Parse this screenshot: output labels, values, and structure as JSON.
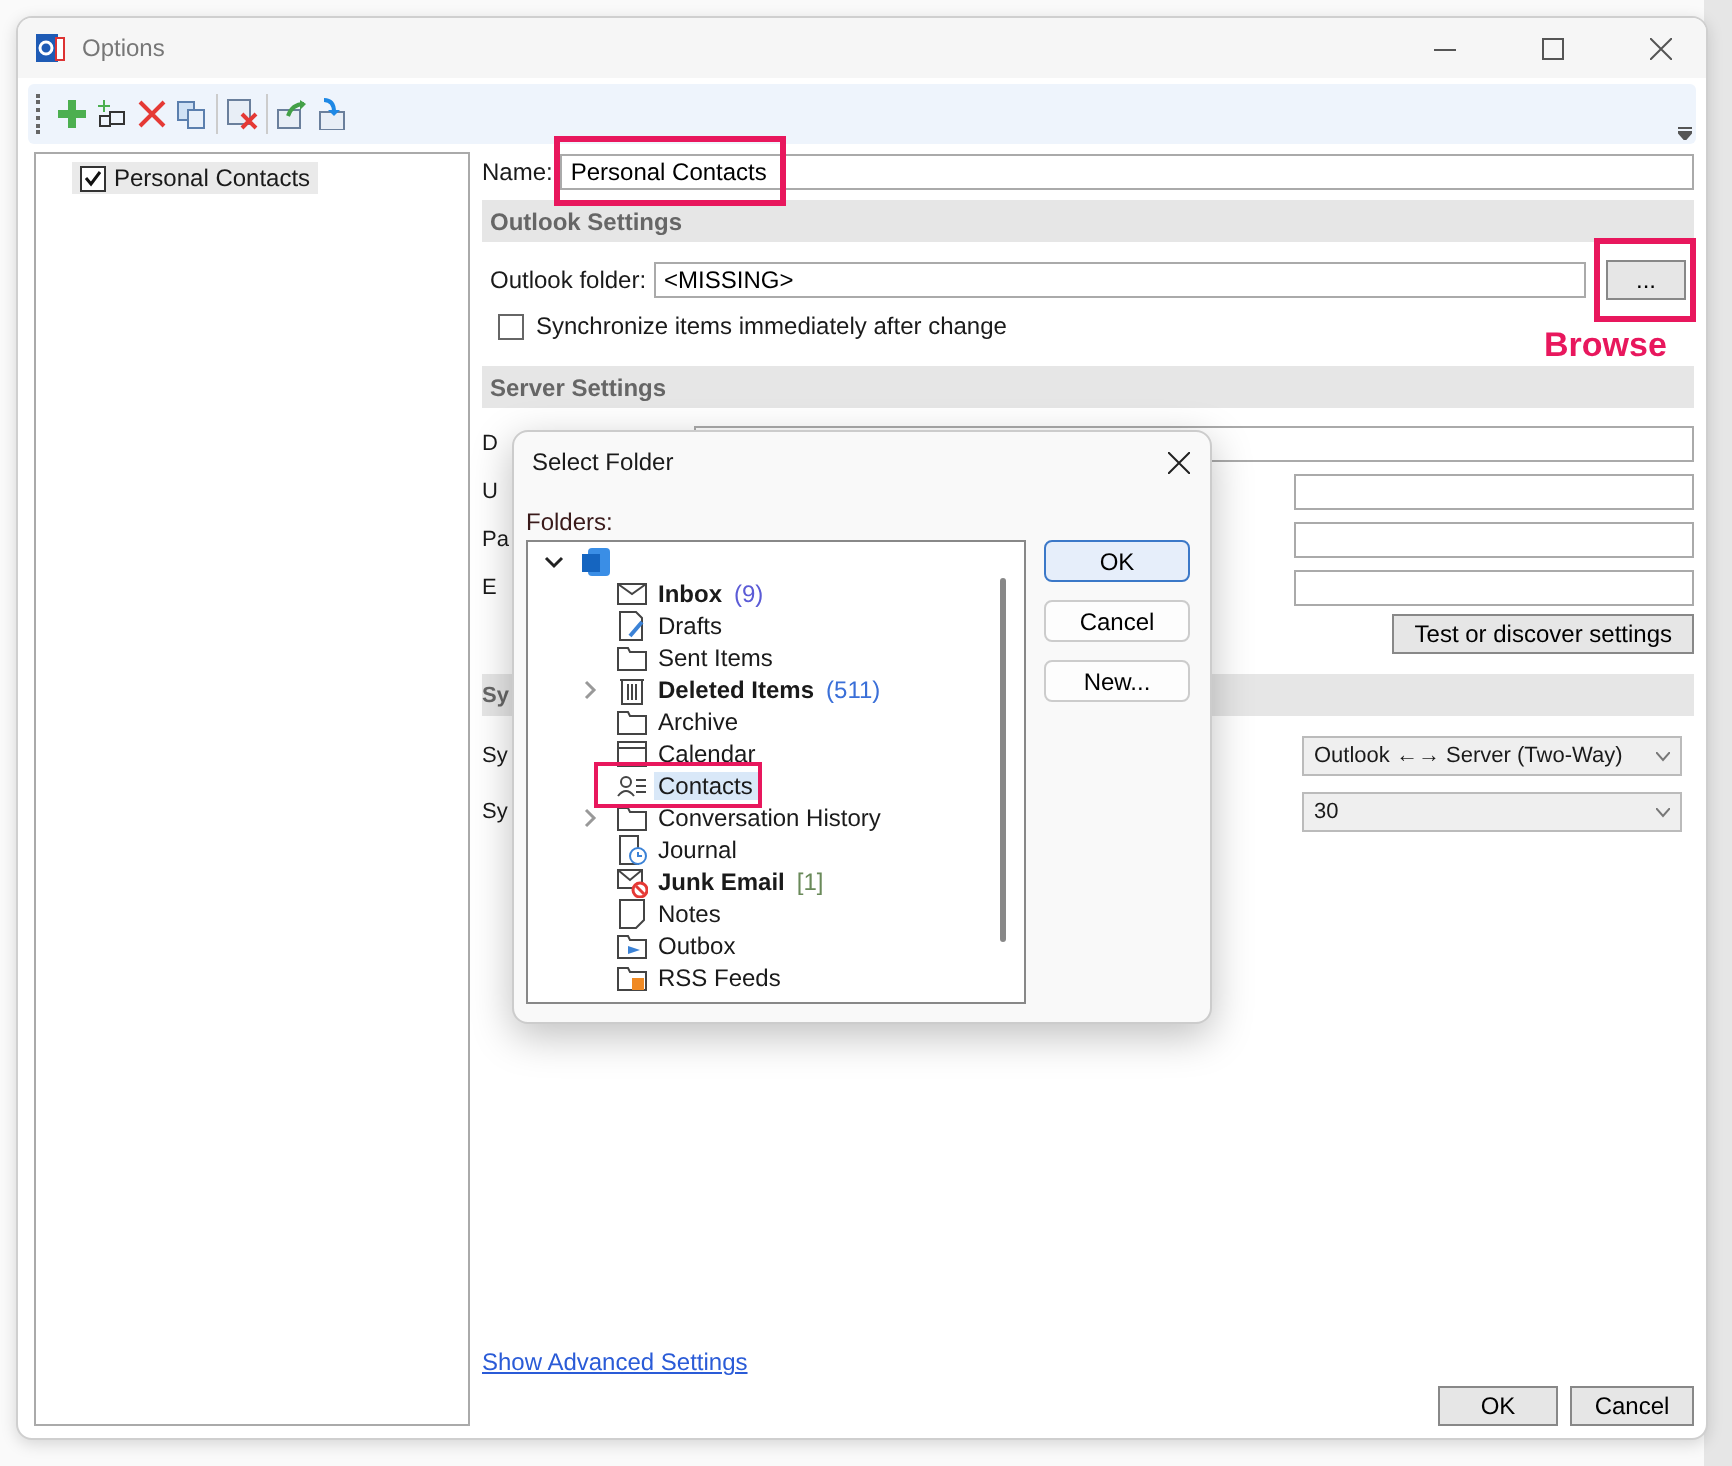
{
  "window": {
    "title": "Options"
  },
  "toolbar": [
    {
      "kind": "add"
    },
    {
      "kind": "add-multiple"
    },
    {
      "kind": "delete"
    },
    {
      "kind": "copy"
    },
    {
      "kind": "clear"
    },
    {
      "kind": "export"
    },
    {
      "kind": "import"
    }
  ],
  "profiles": [
    {
      "label": "Personal Contacts",
      "checked": true,
      "selected": true
    }
  ],
  "name": {
    "label": "Name:",
    "value": "Personal Contacts"
  },
  "outlook_settings": {
    "title": "Outlook Settings",
    "folder_label": "Outlook folder:",
    "folder_value": "<MISSING>",
    "browse_button": "...",
    "sync_immediately": {
      "label": "Synchronize items immediately after change",
      "checked": false
    }
  },
  "server_settings": {
    "title": "Server Settings",
    "rows": [
      {
        "label": "D"
      },
      {
        "label": "U"
      },
      {
        "label": "Pa"
      },
      {
        "label": "E"
      }
    ],
    "test_button": "Test or discover settings"
  },
  "sync_settings": {
    "title": "Sy",
    "rows": [
      {
        "label": "Sy",
        "value": "Outlook ←→ Server (Two-Way)"
      },
      {
        "label": "Sy",
        "value": "30"
      }
    ]
  },
  "advanced_link": "Show Advanced Settings",
  "buttons": [
    "OK",
    "Cancel"
  ],
  "annotation": {
    "label": "Browse"
  },
  "dialog": {
    "title": "Select Folder",
    "folders_label": "Folders:",
    "buttons": [
      {
        "label": "OK",
        "default": true
      },
      {
        "label": "Cancel",
        "default": false
      },
      {
        "label": "New...",
        "default": false
      }
    ],
    "root": {
      "expanded": true,
      "children": [
        {
          "label": "Inbox",
          "count": "(9)",
          "color": "#5b5bd6",
          "bold": true,
          "kind": "mail",
          "expandable": false,
          "selected": false
        },
        {
          "label": "Drafts",
          "bold": false,
          "kind": "draft",
          "expandable": false,
          "selected": false
        },
        {
          "label": "Sent Items",
          "bold": false,
          "kind": "folder",
          "expandable": false,
          "selected": false
        },
        {
          "label": "Deleted Items",
          "count": "(511)",
          "color": "#3a6fd8",
          "bold": true,
          "kind": "trash",
          "expandable": true,
          "selected": false
        },
        {
          "label": "Archive",
          "bold": false,
          "kind": "folder",
          "expandable": false,
          "selected": false
        },
        {
          "label": "Calendar",
          "bold": false,
          "kind": "calendar",
          "expandable": false,
          "selected": false
        },
        {
          "label": "Contacts",
          "bold": false,
          "kind": "contacts",
          "expandable": false,
          "selected": true
        },
        {
          "label": "Conversation History",
          "bold": false,
          "kind": "folder",
          "expandable": true,
          "selected": false
        },
        {
          "label": "Journal",
          "bold": false,
          "kind": "journal",
          "expandable": false,
          "selected": false
        },
        {
          "label": "Junk Email",
          "count": "[1]",
          "color": "#6a8a5a",
          "bold": true,
          "kind": "junk",
          "expandable": false,
          "selected": false
        },
        {
          "label": "Notes",
          "bold": false,
          "kind": "note",
          "expandable": false,
          "selected": false
        },
        {
          "label": "Outbox",
          "bold": false,
          "kind": "outbox",
          "expandable": false,
          "selected": false
        },
        {
          "label": "RSS Feeds",
          "bold": false,
          "kind": "rss",
          "expandable": false,
          "selected": false
        }
      ]
    }
  }
}
